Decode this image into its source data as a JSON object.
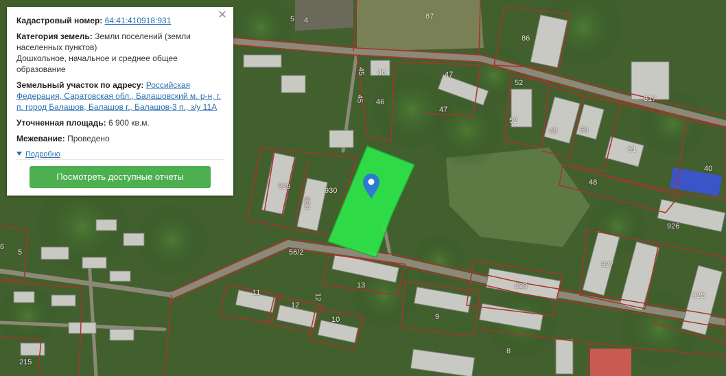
{
  "popup": {
    "cadastral_number_label": "Кадастровый номер:",
    "cadastral_number": "64:41:410918:931",
    "land_category_label": "Категория земель:",
    "land_category": "Земли поселений (земли населенных пунктов)",
    "permitted_use": "Дошкольное, начальное и среднее общее образование",
    "address_label": "Земельный участок по адресу:",
    "address": "Российская Федерация, Саратовская обл., Балашовский м. р-н, г. п. город Балашов, Балашов г., Балашов-3 п., з/у 11А",
    "area_label": "Уточненная площадь:",
    "area": "6 900 кв.м.",
    "survey_label": "Межевание:",
    "survey": "Проведено",
    "details_link": "Подробно",
    "reports_button": "Посмотреть доступные отчеты",
    "close_icon": "close-icon"
  },
  "map": {
    "marker_icon": "map-pin-icon",
    "highlight_color": "#2ee84a",
    "boundary_color": "#a8342c",
    "plot_labels": [
      {
        "id": "p87",
        "text": "87"
      },
      {
        "id": "p5a",
        "text": "5"
      },
      {
        "id": "p4",
        "text": "4"
      },
      {
        "id": "p86",
        "text": "86"
      },
      {
        "id": "p45a",
        "text": "45"
      },
      {
        "id": "p46a",
        "text": "46"
      },
      {
        "id": "p47a",
        "text": "47"
      },
      {
        "id": "p45b",
        "text": "45"
      },
      {
        "id": "p46b",
        "text": "46"
      },
      {
        "id": "p47b",
        "text": "47"
      },
      {
        "id": "p52a",
        "text": "52"
      },
      {
        "id": "p52b",
        "text": "52"
      },
      {
        "id": "p317",
        "text": "317"
      },
      {
        "id": "p49",
        "text": "49"
      },
      {
        "id": "p50",
        "text": "50"
      },
      {
        "id": "p51",
        "text": "51"
      },
      {
        "id": "p40",
        "text": "40"
      },
      {
        "id": "p48",
        "text": "48"
      },
      {
        "id": "p929",
        "text": "929"
      },
      {
        "id": "p930a",
        "text": "930"
      },
      {
        "id": "p930b",
        "text": "930"
      },
      {
        "id": "p926",
        "text": "926"
      },
      {
        "id": "p927",
        "text": "927"
      },
      {
        "id": "p928",
        "text": "928"
      },
      {
        "id": "p925",
        "text": "925"
      },
      {
        "id": "p562",
        "text": "56/2"
      },
      {
        "id": "p13",
        "text": "13"
      },
      {
        "id": "p11",
        "text": "11"
      },
      {
        "id": "p12a",
        "text": "12"
      },
      {
        "id": "p12b",
        "text": "12"
      },
      {
        "id": "p10",
        "text": "10"
      },
      {
        "id": "p9",
        "text": "9"
      },
      {
        "id": "p8",
        "text": "8"
      },
      {
        "id": "p6",
        "text": "6"
      },
      {
        "id": "p5b",
        "text": "5"
      },
      {
        "id": "p215",
        "text": "215"
      }
    ]
  }
}
